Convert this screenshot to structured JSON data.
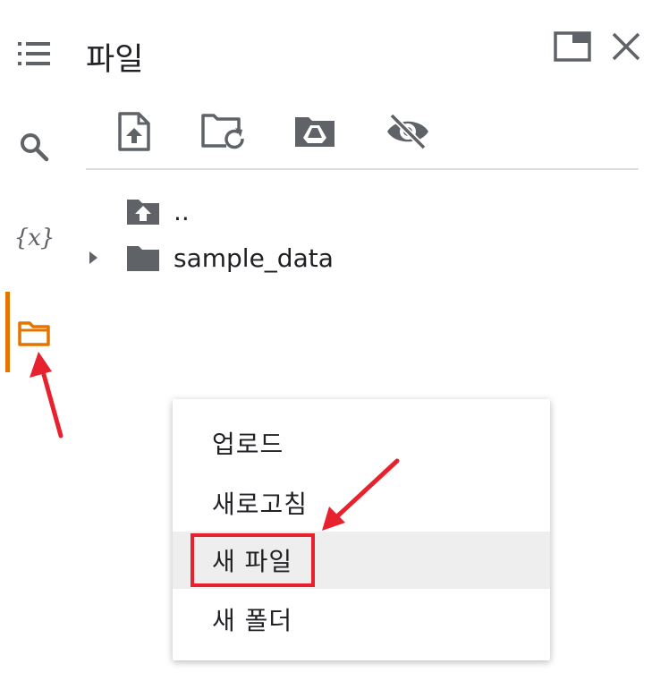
{
  "panel": {
    "title": "파일"
  },
  "tree": {
    "items": [
      {
        "label": ".."
      },
      {
        "label": "sample_data"
      }
    ]
  },
  "context_menu": {
    "items": [
      {
        "label": "업로드"
      },
      {
        "label": "새로고침"
      },
      {
        "label": "새 파일"
      },
      {
        "label": "새 폴더"
      }
    ]
  },
  "icons": {
    "rail": [
      "list-icon",
      "search-icon",
      "variables-icon",
      "folder-icon"
    ],
    "toolbar": [
      "upload-file-icon",
      "refresh-folder-icon",
      "mount-drive-icon",
      "hide-files-icon"
    ],
    "window": [
      "maximize-icon",
      "close-icon"
    ]
  },
  "colors": {
    "accent": "#e37400",
    "annotation": "#e8212e",
    "icon": "#5f6368",
    "highlight": "#eeeeee"
  },
  "variables_icon_text": "{x}"
}
